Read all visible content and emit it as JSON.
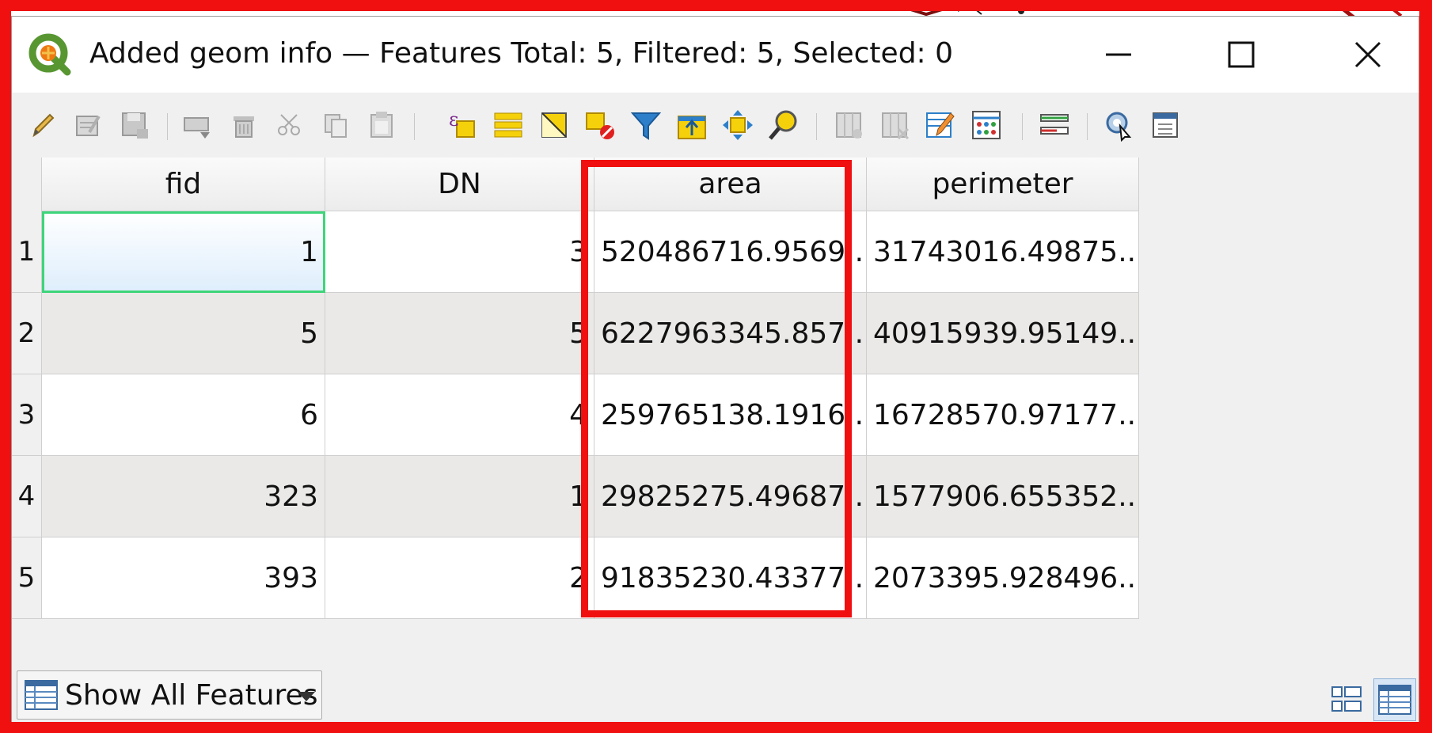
{
  "window": {
    "title": "Added geom info — Features Total: 5, Filtered: 5, Selected: 0"
  },
  "toolbar": {
    "icons": [
      "pencil-icon",
      "multi-edit-icon",
      "save-edits-icon",
      "add-feature-icon",
      "delete-feature-icon",
      "cut-icon",
      "copy-icon",
      "paste-icon",
      "expression-select-icon",
      "select-all-icon",
      "invert-selection-icon",
      "deselect-icon",
      "filter-icon",
      "move-selection-top-icon",
      "pan-to-selection-icon",
      "zoom-to-selection-icon",
      "new-field-icon",
      "delete-field-icon",
      "field-calculator-icon",
      "conditional-formatting-icon",
      "organize-columns-icon",
      "actions-icon",
      "dock-icon"
    ]
  },
  "table": {
    "headers": [
      "fid",
      "DN",
      "area",
      "perimeter"
    ],
    "rows": [
      {
        "num": "1",
        "fid": "1",
        "dn": "3",
        "area": "520486716.9569...",
        "perimeter": "31743016.49875..."
      },
      {
        "num": "2",
        "fid": "5",
        "dn": "5",
        "area": "6227963345.857...",
        "perimeter": "40915939.95149..."
      },
      {
        "num": "3",
        "fid": "6",
        "dn": "4",
        "area": "259765138.1916...",
        "perimeter": "16728570.97177..."
      },
      {
        "num": "4",
        "fid": "323",
        "dn": "1",
        "area": "29825275.49687...",
        "perimeter": "1577906.655352..."
      },
      {
        "num": "5",
        "fid": "393",
        "dn": "2",
        "area": "91835230.43377...",
        "perimeter": "2073395.928496..."
      }
    ]
  },
  "bottom": {
    "filter_label": "Show All Features"
  },
  "colors": {
    "highlight": "#f01010",
    "selection_border": "#3ed57a",
    "alt_row": "#ebe9e7"
  }
}
